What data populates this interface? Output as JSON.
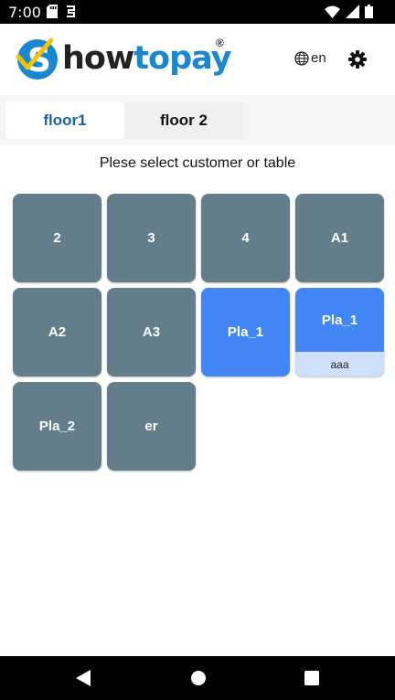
{
  "status_bar": {
    "time": "7:00",
    "icons_left": [
      "sd-card-icon",
      "sync-icon"
    ],
    "icons_right": [
      "wifi-icon",
      "signal-icon",
      "battery-icon"
    ]
  },
  "header": {
    "logo": {
      "how": "how",
      "to": "to",
      "pay": "pay",
      "reg": "®"
    },
    "language": "en"
  },
  "tabs": [
    {
      "label": "floor1",
      "active": true
    },
    {
      "label": "floor 2",
      "active": false
    }
  ],
  "prompt": "Plese select customer or table",
  "tables": [
    {
      "label": "2",
      "status": "free"
    },
    {
      "label": "3",
      "status": "free"
    },
    {
      "label": "4",
      "status": "free"
    },
    {
      "label": "A1",
      "status": "free"
    },
    {
      "label": "A2",
      "status": "free"
    },
    {
      "label": "A3",
      "status": "free"
    },
    {
      "label": "Pla_1",
      "status": "occupied"
    },
    {
      "label": "Pla_1",
      "status": "occupied",
      "sub": "aaa"
    },
    {
      "label": "Pla_2",
      "status": "free"
    },
    {
      "label": "er",
      "status": "free"
    }
  ],
  "colors": {
    "free_tile": "#637d8a",
    "occupied_tile": "#4286f5",
    "sub_label_bg": "#cfdefa",
    "brand_blue": "#1a87d2",
    "active_tab_text": "#1d5fa8"
  }
}
